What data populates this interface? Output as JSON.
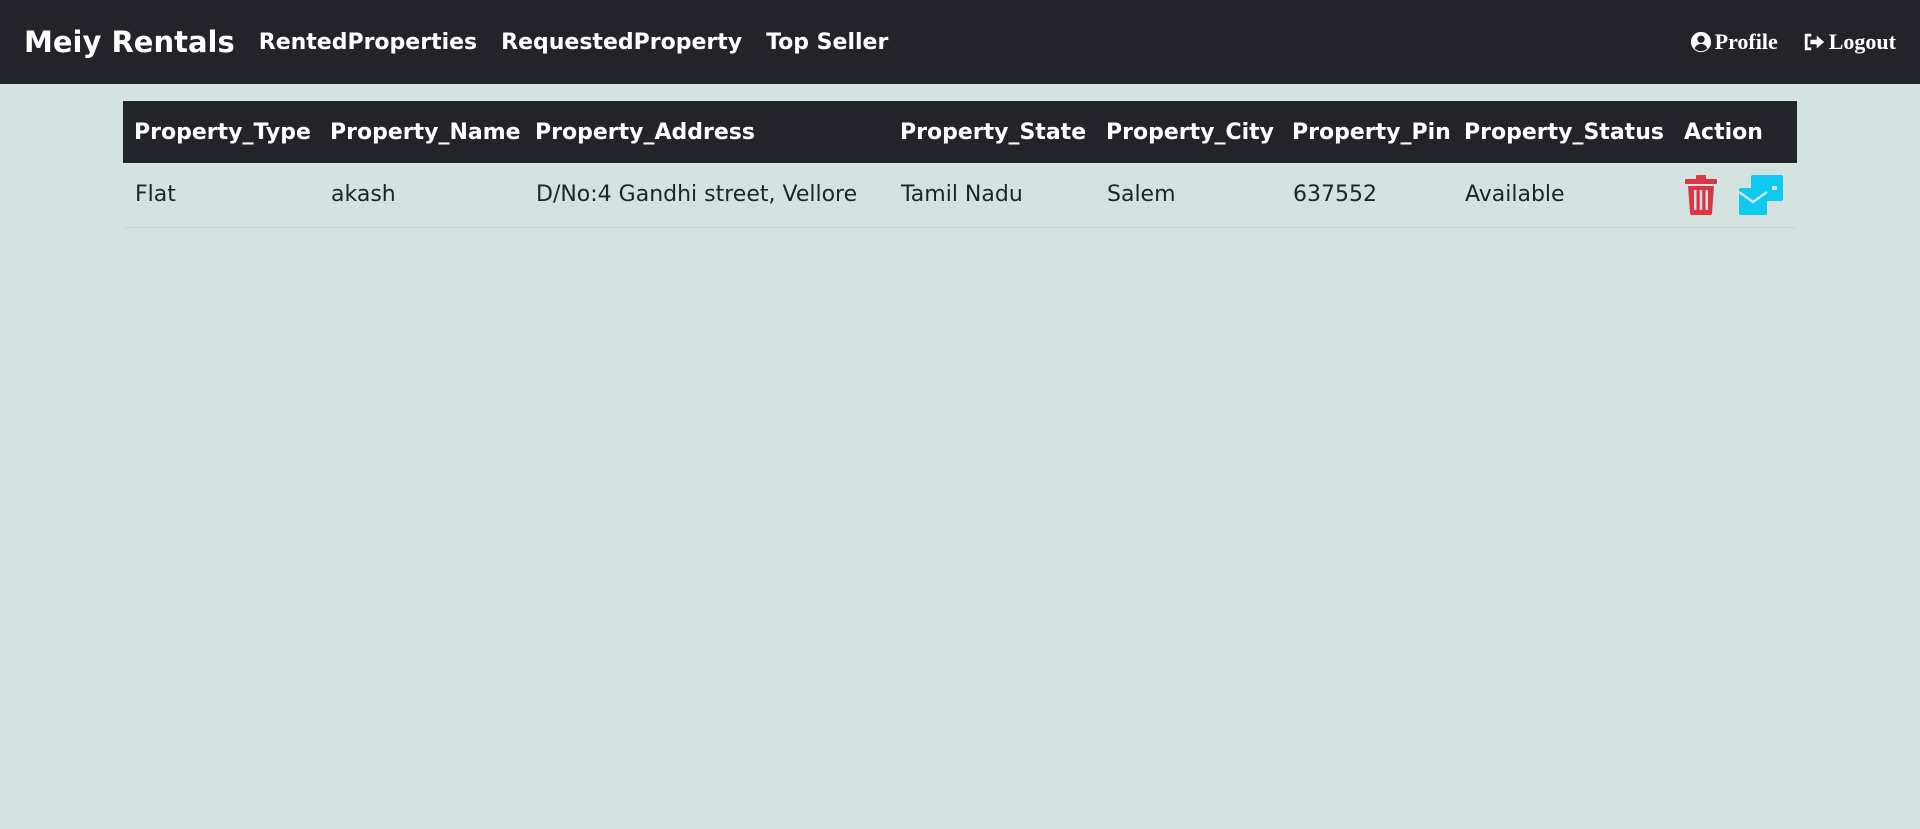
{
  "navbar": {
    "brand": "Meiy Rentals",
    "links": [
      {
        "label": "RentedProperties"
      },
      {
        "label": "RequestedProperty"
      },
      {
        "label": "Top Seller"
      }
    ],
    "profile_label": "Profile",
    "logout_label": "Logout"
  },
  "table": {
    "columns": [
      "Property_Type",
      "Property_Name",
      "Property_Address",
      "Property_State",
      "Property_City",
      "Property_Pin",
      "Property_Status",
      "Action"
    ],
    "rows": [
      {
        "type": "Flat",
        "name": "akash",
        "address": "D/No:4 Gandhi street, Vellore",
        "state": "Tamil Nadu",
        "city": "Salem",
        "pin": "637552",
        "status": "Available",
        "actions": [
          "trash-icon",
          "envelopes-icon"
        ]
      }
    ]
  },
  "colors": {
    "navbar_bg": "#212529",
    "page_bg": "#d4e2e0",
    "delete": "#dc3545",
    "message": "#0dcaf0"
  }
}
